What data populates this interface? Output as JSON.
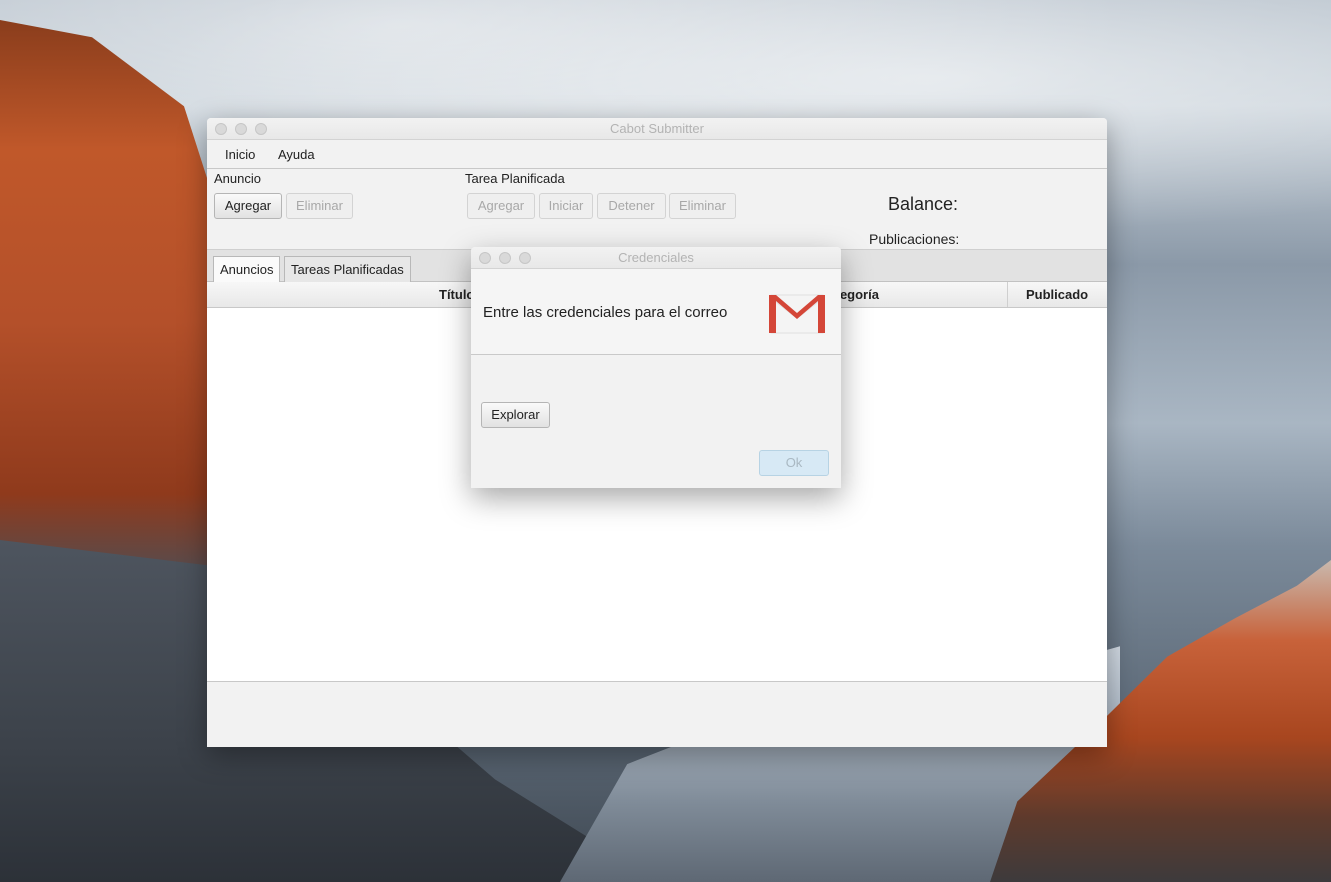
{
  "main_window": {
    "title": "Cabot Submitter",
    "menu": [
      "Inicio",
      "Ayuda"
    ],
    "anuncio_group": {
      "label": "Anuncio",
      "add_label": "Agregar",
      "delete_label": "Eliminar"
    },
    "tarea_group": {
      "label": "Tarea Planificada",
      "add_label": "Agregar",
      "start_label": "Iniciar",
      "stop_label": "Detener",
      "delete_label": "Eliminar"
    },
    "balance_label": "Balance:",
    "publications_label": "Publicaciones:",
    "tabs": [
      "Anuncios",
      "Tareas Planificadas"
    ],
    "table_columns": [
      "Título",
      "Categoría",
      "Publicado"
    ]
  },
  "dialog": {
    "title": "Credenciales",
    "message": "Entre las credenciales para el correo",
    "icon": "gmail-icon",
    "explore_label": "Explorar",
    "ok_label": "Ok"
  },
  "colors": {
    "gmail_red": "#d44638",
    "ok_button_bg": "#d7e9f5"
  }
}
